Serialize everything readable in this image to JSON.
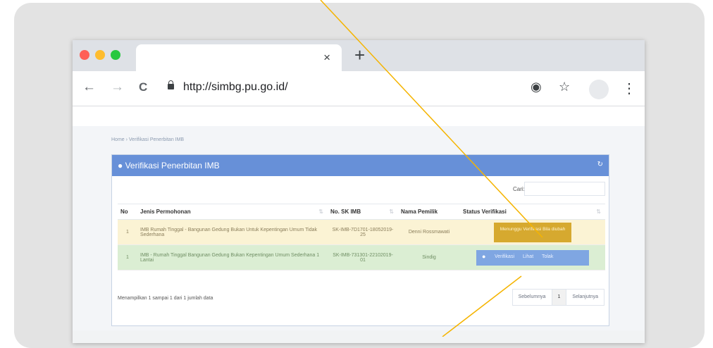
{
  "browser": {
    "url": "http://simbg.pu.go.id/",
    "tab_close": "×",
    "new_tab": "+",
    "back": "←",
    "forward": "→",
    "reload": "C",
    "location_icon": "◉",
    "star": "☆",
    "menu": "⋮",
    "traffic_colors": [
      "#ff5f57",
      "#febc2e",
      "#28c840"
    ]
  },
  "page": {
    "breadcrumb": "Home › Verifikasi Penerbitan IMB",
    "panel_title": "● Verifikasi Penerbitan IMB",
    "refresh_icon": "↻",
    "search_label": "Cari:",
    "table": {
      "headers": [
        "No",
        "Jenis Permohonan",
        "No. SK IMB",
        "Nama Pemilik",
        "Status Verifikasi"
      ],
      "rows": [
        {
          "no": "1",
          "jenis": "IMB Rumah Tinggal - Bangunan Gedung Bukan Untuk Kepentingan Umum Tidak Sederhana",
          "sk": "SK-IMB-7D1701-18052019-25",
          "pemilik": "Denni Rossmawati",
          "status": "Menunggu Verifikasi Bila diubah"
        },
        {
          "no": "1",
          "jenis": "IMB - Rumah Tinggal Bangunan Gedung Bukan Kepentingan Umum Sederhana 1 Lantai",
          "sk": "SK-IMB-731301-22102019-01",
          "pemilik": "Sindig",
          "actions": [
            "Verifikasi",
            "Lihat",
            "Tolak"
          ]
        }
      ]
    },
    "footer": "Menampilkan 1 sampai 1 dari 1 jumlah data",
    "pager": [
      "Sebelumnya",
      "1",
      "Selanjutnya"
    ]
  },
  "colors": {
    "header_blue": "#6790d8",
    "pending_row": "#fbf3d4",
    "verified_row": "#dbeed3",
    "badge_gold": "#d6a92f",
    "callout_line": "#f5b400"
  }
}
